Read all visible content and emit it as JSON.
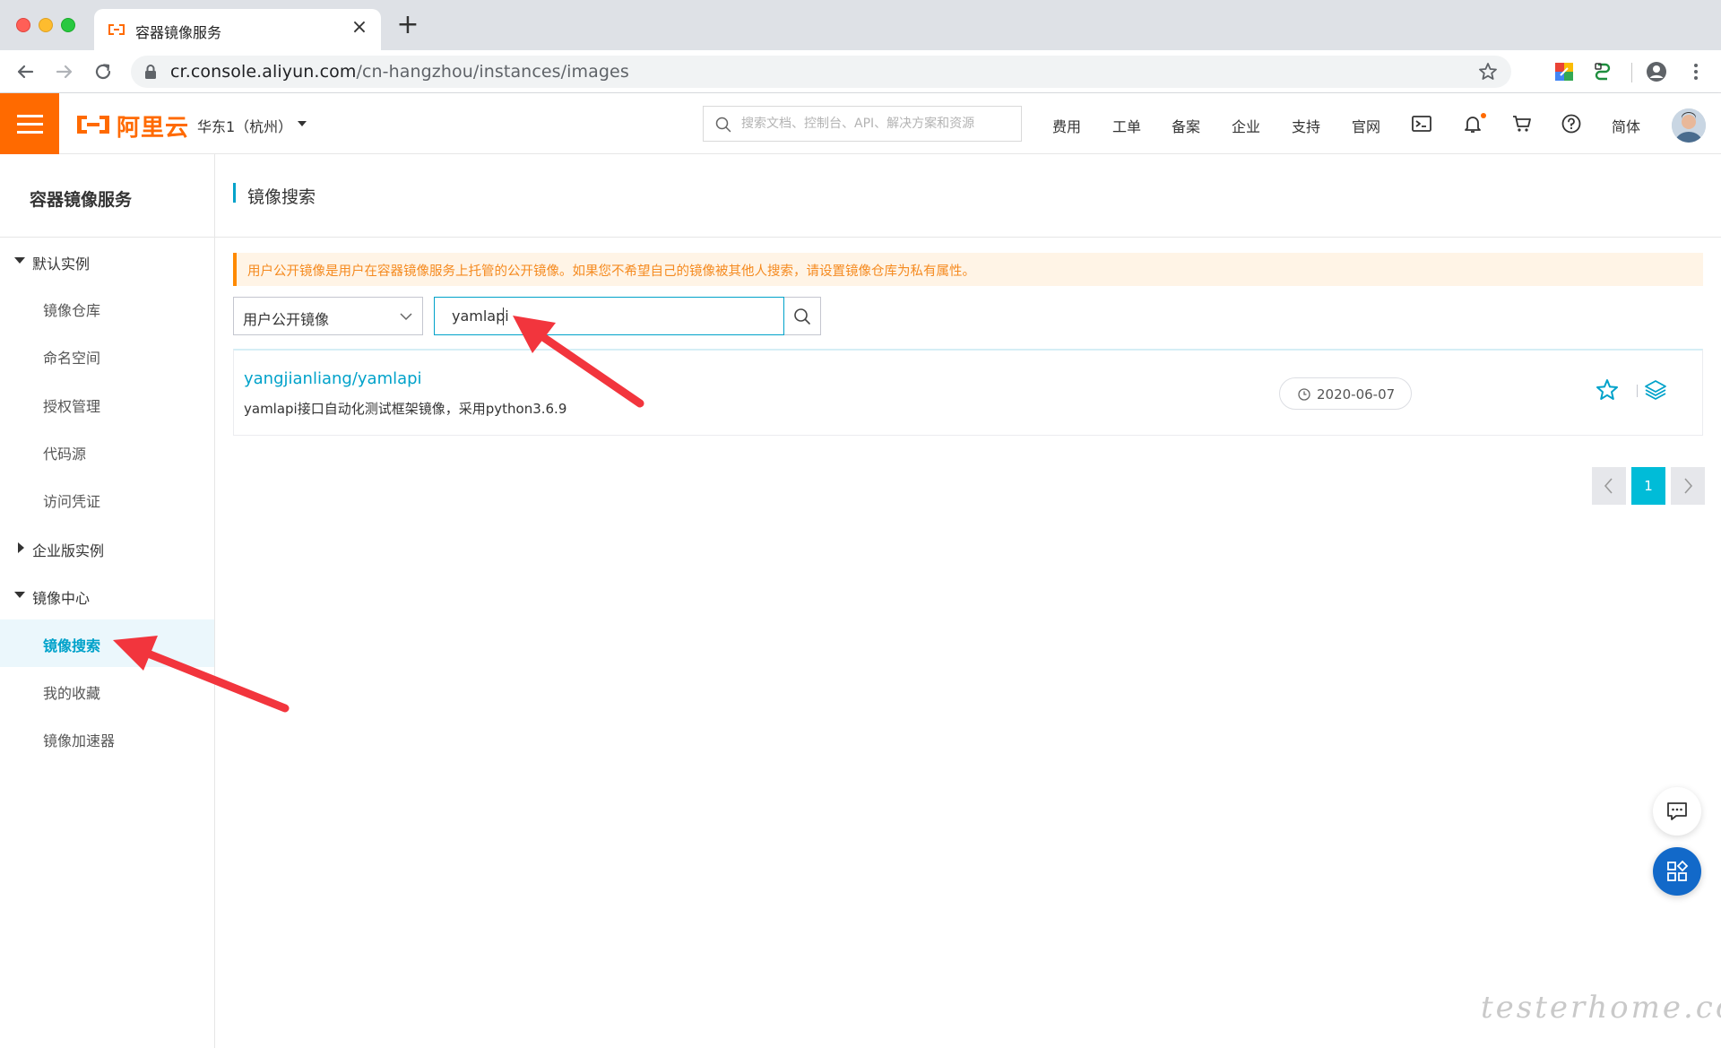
{
  "browser": {
    "tab_title": "容器镜像服务",
    "url_host": "cr.console.aliyun.com",
    "url_path": "/cn-hangzhou/instances/images",
    "close_glyph": "×",
    "newtab_glyph": "+"
  },
  "topbar": {
    "logo_text": "阿里云",
    "region": "华东1（杭州）",
    "search_placeholder": "搜索文档、控制台、API、解决方案和资源",
    "nav": [
      "费用",
      "工单",
      "备案",
      "企业",
      "支持",
      "官网"
    ],
    "lang": "简体",
    "brand_color": "#ff6a00"
  },
  "sidebar": {
    "title": "容器镜像服务",
    "groups": [
      {
        "label": "默认实例",
        "expanded": true,
        "items": [
          "镜像仓库",
          "命名空间",
          "授权管理",
          "代码源",
          "访问凭证"
        ]
      },
      {
        "label": "企业版实例",
        "expanded": false,
        "items": []
      },
      {
        "label": "镜像中心",
        "expanded": true,
        "items": [
          "镜像搜索",
          "我的收藏",
          "镜像加速器"
        ]
      }
    ],
    "active_item": "镜像搜索",
    "accent_color": "#00a2ca"
  },
  "main": {
    "page_title": "镜像搜索",
    "notice": "用户公开镜像是用户在容器镜像服务上托管的公开镜像。如果您不希望自己的镜像被其他人搜索，请设置镜像仓库为私有属性。",
    "filter_select": "用户公开镜像",
    "search_value": "yamlapi",
    "results": [
      {
        "name": "yangjianliang/yamlapi",
        "description": "yamlapi接口自动化测试框架镜像，采用python3.6.9",
        "date": "2020-06-07"
      }
    ],
    "pagination": {
      "current": "1"
    }
  },
  "watermark": "testerhome.com",
  "icons": {
    "search": "search-icon",
    "star": "star-icon",
    "layers": "layers-icon",
    "clock": "clock-icon",
    "bell": "bell-icon",
    "cart": "cart-icon",
    "help": "help-icon",
    "terminal": "terminal-icon",
    "chat": "chat-icon",
    "apps": "apps-icon"
  }
}
